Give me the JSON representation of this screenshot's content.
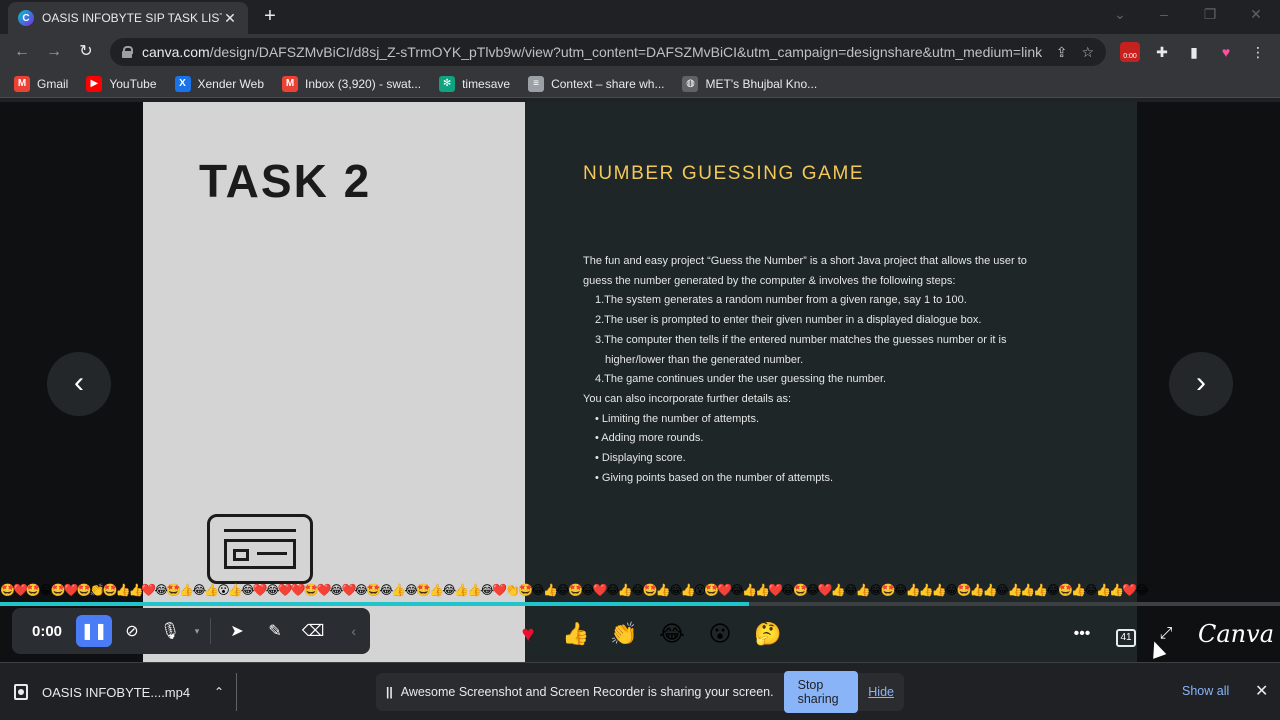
{
  "browser": {
    "tab_title": "OASIS INFOBYTE SIP TASK LIST",
    "favicon_letter": "C",
    "url_domain": "canva.com",
    "url_path": "/design/DAFSZMvBiCI/d8sj_Z-sTrmOYK_pTlvb9w/view?utm_content=DAFSZMvBiCI&utm_campaign=designshare&utm_medium=link...",
    "recorder_badge": "0:00",
    "bookmarks": [
      {
        "label": "Gmail",
        "icon": "gmail-icon",
        "color": "#ea4335",
        "glyph": "M"
      },
      {
        "label": "YouTube",
        "icon": "youtube-icon",
        "color": "#ff0000",
        "glyph": "▶"
      },
      {
        "label": "Xender Web",
        "icon": "xender-icon",
        "color": "#1a73e8",
        "glyph": "X"
      },
      {
        "label": "Inbox (3,920) - swat...",
        "icon": "gmail-icon",
        "color": "#ea4335",
        "glyph": "M"
      },
      {
        "label": "timesave",
        "icon": "chatgpt-icon",
        "color": "#10a37f",
        "glyph": "✻"
      },
      {
        "label": "Context – share wh...",
        "icon": "document-icon",
        "color": "#9aa0a6",
        "glyph": "≡"
      },
      {
        "label": "MET's Bhujbal Kno...",
        "icon": "globe-icon",
        "color": "#5f6368",
        "glyph": "◍"
      }
    ]
  },
  "slide": {
    "task_title": "TASK 2",
    "game_title": "NUMBER GUESSING GAME",
    "lines": [
      {
        "text": "The fun and easy project “Guess the Number” is a short Java project that allows the user to",
        "indent": ""
      },
      {
        "text": "guess the number generated by the computer & involves the following steps:",
        "indent": ""
      },
      {
        "text": "1.The system generates a random number from a given range, say 1 to 100.",
        "indent": "ind"
      },
      {
        "text": "2.The user is prompted to enter their given number in a displayed dialogue box.",
        "indent": "ind"
      },
      {
        "text": "3.The computer then tells if the entered number matches the guesses number or it is",
        "indent": "ind"
      },
      {
        "text": "higher/lower than the generated number.",
        "indent": "ind2"
      },
      {
        "text": "4.The game continues under the user guessing the number.",
        "indent": "ind"
      },
      {
        "text": "You can also incorporate further details as:",
        "indent": ""
      },
      {
        "text": "• Limiting the number of attempts.",
        "indent": "ind"
      },
      {
        "text": "• Adding more rounds.",
        "indent": "ind"
      },
      {
        "text": "• Displaying score.",
        "indent": "ind"
      },
      {
        "text": "• Giving points based on the number of attempts.",
        "indent": "ind"
      }
    ]
  },
  "player": {
    "time": "0:00",
    "progress_fraction": 0.585,
    "reaction_stream": "🤩❤️🤩😂🤩❤️🤩👏🤩👍👍❤️😂🤩👍😂👍😮👍😂❤️😂❤️❤️🤩❤️😂❤️😂🤩😂👍😂🤩👍😂👍👍😂❤️👏🤩😂👍😂🤩😂❤️😂👍😂🤩👍😂👍😮🤩❤️😂👍👍❤️😂🤩😂❤️👍😂👍😂🤩😂👍👍👍😂🤩👍👍😂👍👍👍😂🤩👍😂👍👍❤️😂",
    "emojis": [
      {
        "glyph": "♥",
        "name": "heart-reaction-button"
      },
      {
        "glyph": "👍",
        "name": "thumbs-up-reaction-button"
      },
      {
        "glyph": "👏",
        "name": "clap-reaction-button"
      },
      {
        "glyph": "😂",
        "name": "laugh-reaction-button"
      },
      {
        "glyph": "😮",
        "name": "surprised-reaction-button"
      },
      {
        "glyph": "🤔",
        "name": "thinking-reaction-button"
      }
    ],
    "page_count": "41",
    "brand": "Canva"
  },
  "shelf": {
    "download_name": "OASIS INFOBYTE....mp4",
    "share_message": "Awesome Screenshot and Screen Recorder is sharing your screen.",
    "stop_label": "Stop sharing",
    "hide_label": "Hide",
    "show_all_label": "Show all"
  },
  "colors": {
    "accent": "#20c4cb",
    "title_gold": "#f3c858",
    "play_button": "#4a7cf6",
    "link_blue": "#8ab4f8"
  }
}
